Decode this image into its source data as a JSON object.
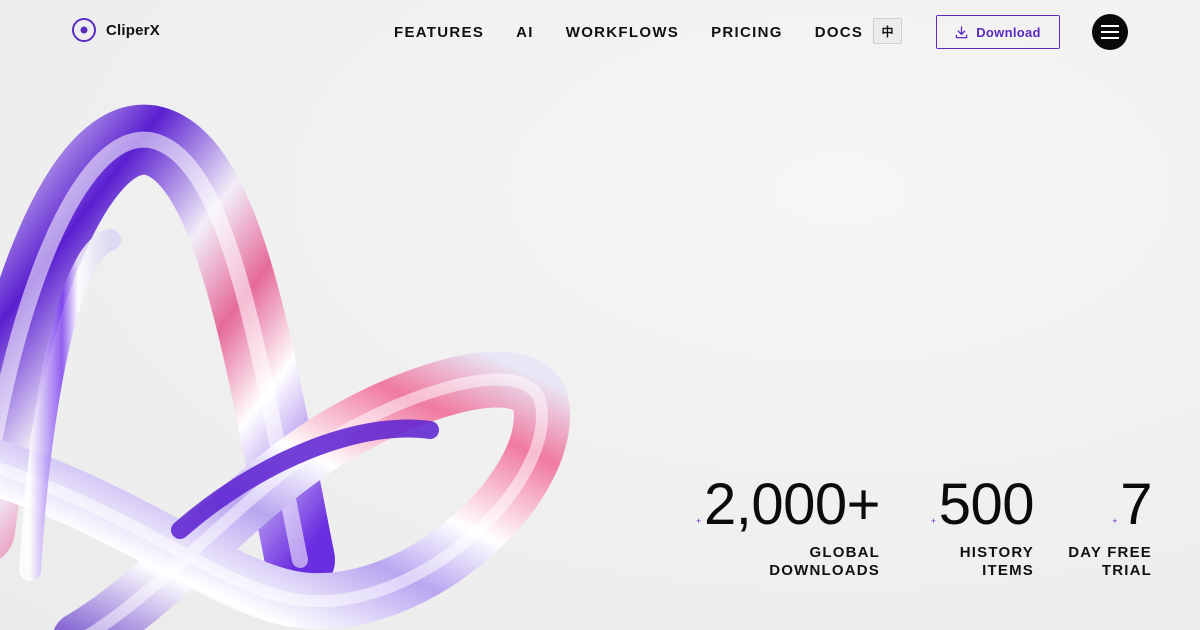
{
  "brand": {
    "name": "CliperX",
    "accent": "#5b2bbf"
  },
  "nav": {
    "items": [
      {
        "label": "FEATURES"
      },
      {
        "label": "AI"
      },
      {
        "label": "WORKFLOWS"
      },
      {
        "label": "PRICING"
      },
      {
        "label": "DOCS"
      }
    ],
    "language_label": "中",
    "download_label": "Download"
  },
  "stats": [
    {
      "value": "2,000+",
      "plus": "+",
      "label_line1": "GLOBAL",
      "label_line2": "DOWNLOADS"
    },
    {
      "value": "500",
      "plus": "+",
      "label_line1": "HISTORY",
      "label_line2": "ITEMS"
    },
    {
      "value": "7",
      "plus": "+",
      "label_line1": "DAY FREE",
      "label_line2": "TRIAL"
    }
  ],
  "icons": [
    "logo-ring-icon",
    "download-icon",
    "hamburger-menu-icon"
  ]
}
